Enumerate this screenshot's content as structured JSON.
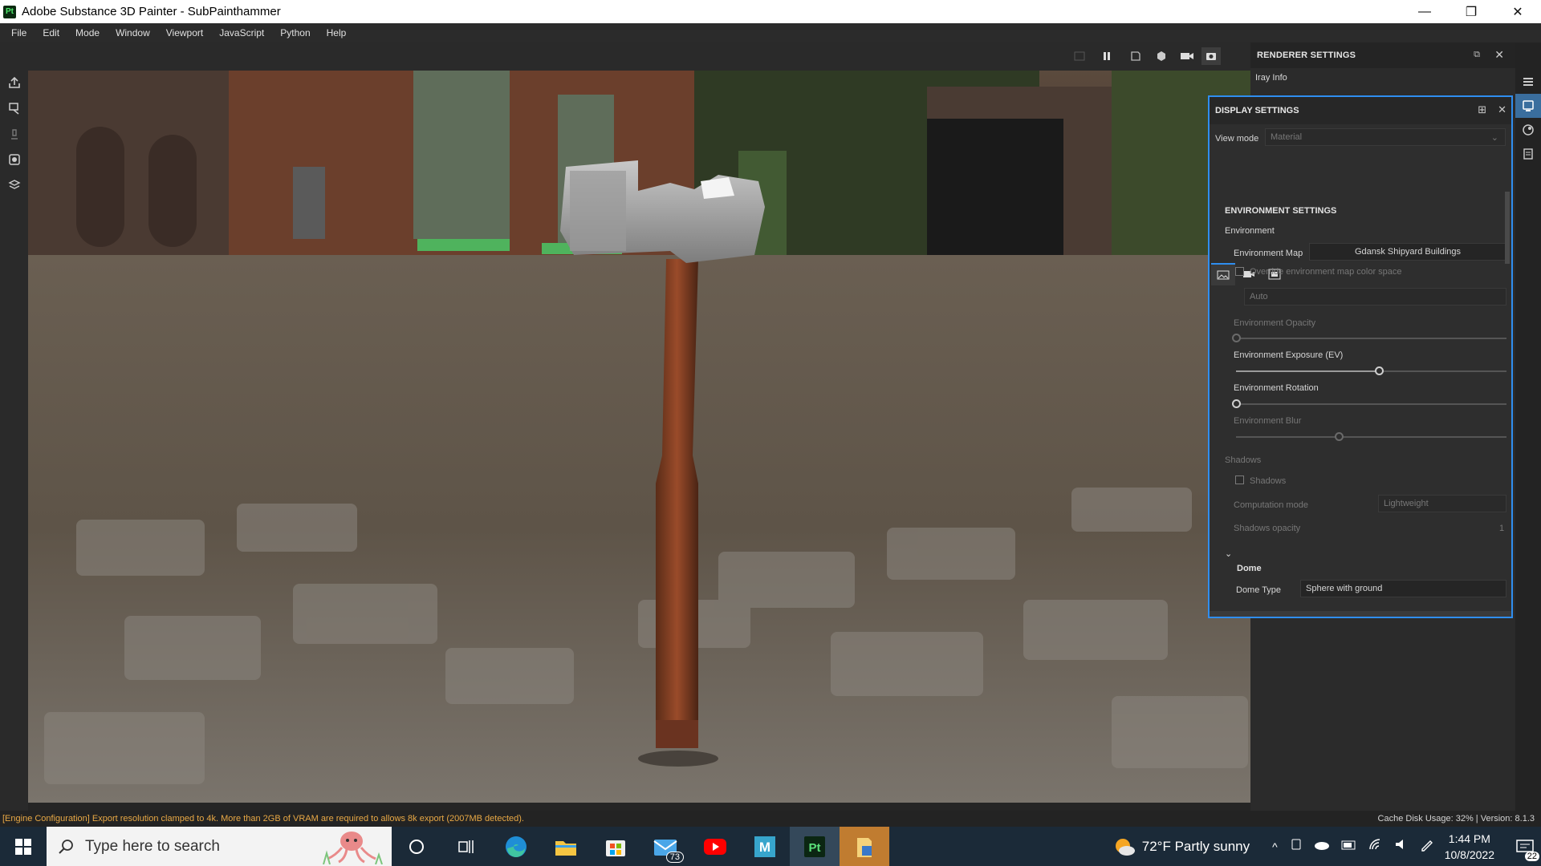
{
  "window": {
    "title": "Adobe Substance 3D Painter - SubPainthammer",
    "app_icon_text": "Pt",
    "minimize": "—",
    "restore": "❐",
    "close": "✕"
  },
  "menu": [
    "File",
    "Edit",
    "Mode",
    "Window",
    "Viewport",
    "JavaScript",
    "Python",
    "Help"
  ],
  "renderer_panel": {
    "title": "RENDERER SETTINGS",
    "iray_info": "Iray Info"
  },
  "display_settings": {
    "title": "DISPLAY SETTINGS",
    "view_mode_label": "View mode",
    "view_mode_value": "Material",
    "section_title": "ENVIRONMENT SETTINGS",
    "environment_group": "Environment",
    "environment_map_label": "Environment Map",
    "environment_map_value": "Gdansk Shipyard Buildings",
    "override_color_space": "Override environment map color space",
    "color_space_value": "Auto",
    "environment_opacity": "Environment Opacity",
    "environment_exposure": "Environment Exposure (EV)",
    "environment_rotation": "Environment Rotation",
    "environment_blur": "Environment Blur",
    "shadows_group": "Shadows",
    "shadows_checkbox": "Shadows",
    "computation_mode_label": "Computation mode",
    "computation_mode_value": "Lightweight",
    "shadows_opacity": "Shadows opacity",
    "shadows_opacity_value": "1",
    "dome_section": "Dome",
    "dome_type_label": "Dome Type",
    "dome_type_value": "Sphere with ground",
    "sliders": {
      "environment_opacity": 0.0,
      "environment_exposure": 0.53,
      "environment_rotation": 0.0,
      "environment_blur": 0.38
    }
  },
  "status_bar": {
    "message": "[Engine Configuration] Export resolution clamped to 4k. More than 2GB of VRAM are required to allows 8k export (2007MB detected).",
    "cache": "Cache Disk Usage:    32% | Version: 8.1.3"
  },
  "taskbar": {
    "search_placeholder": "Type here to search",
    "mail_badge": "73",
    "weather": "72°F  Partly sunny",
    "time": "1:44 PM",
    "date": "10/8/2022",
    "notification_count": "22"
  },
  "colors": {
    "accent": "#2f8ef0",
    "warning": "#e8a845",
    "panel_bg": "#2e2e2e"
  }
}
